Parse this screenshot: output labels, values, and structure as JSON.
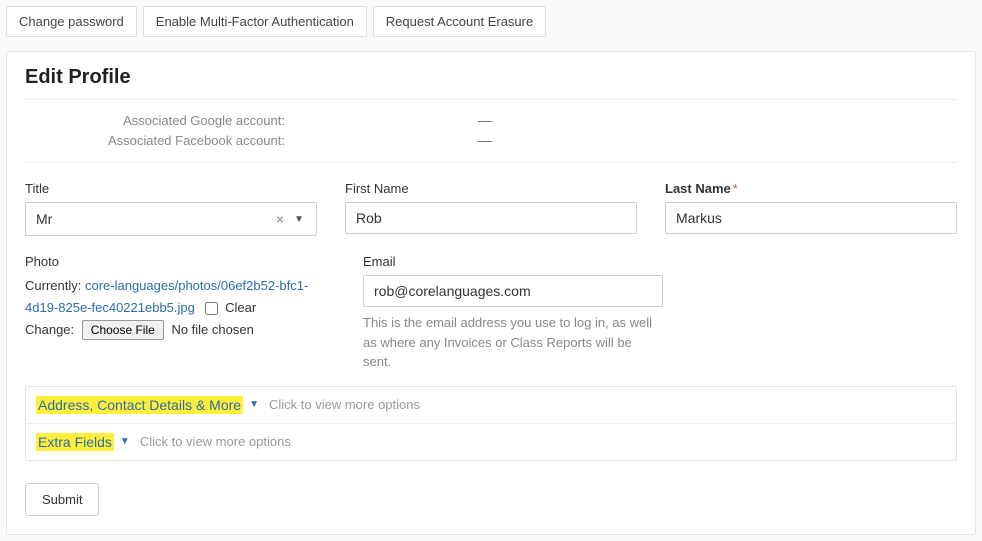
{
  "topButtons": {
    "changePassword": "Change password",
    "enableMfa": "Enable Multi-Factor Authentication",
    "requestErasure": "Request Account Erasure"
  },
  "panel": {
    "heading": "Edit Profile"
  },
  "associated": {
    "googleLabel": "Associated Google account:",
    "googleValue": "—",
    "facebookLabel": "Associated Facebook account:",
    "facebookValue": "—"
  },
  "fields": {
    "title": {
      "label": "Title",
      "value": "Mr"
    },
    "firstName": {
      "label": "First Name",
      "value": "Rob"
    },
    "lastName": {
      "label": "Last Name",
      "value": "Markus",
      "required": "*"
    },
    "photo": {
      "label": "Photo",
      "currentlyLabel": "Currently:",
      "currentLink": "core-languages/photos/06ef2b52-bfc1-4d19-825e-fec40221ebb5.jpg",
      "clearLabel": "Clear",
      "changeLabel": "Change:",
      "chooseFile": "Choose File",
      "noFile": "No file chosen"
    },
    "email": {
      "label": "Email",
      "value": "rob@corelanguages.com",
      "help": "This is the email address you use to log in, as well as where any Invoices or Class Reports will be sent."
    }
  },
  "expanders": {
    "address": {
      "title": "Address, Contact Details & More",
      "hint": "Click to view more options"
    },
    "extra": {
      "title": "Extra Fields",
      "hint": "Click to view more options"
    }
  },
  "submit": {
    "label": "Submit"
  }
}
